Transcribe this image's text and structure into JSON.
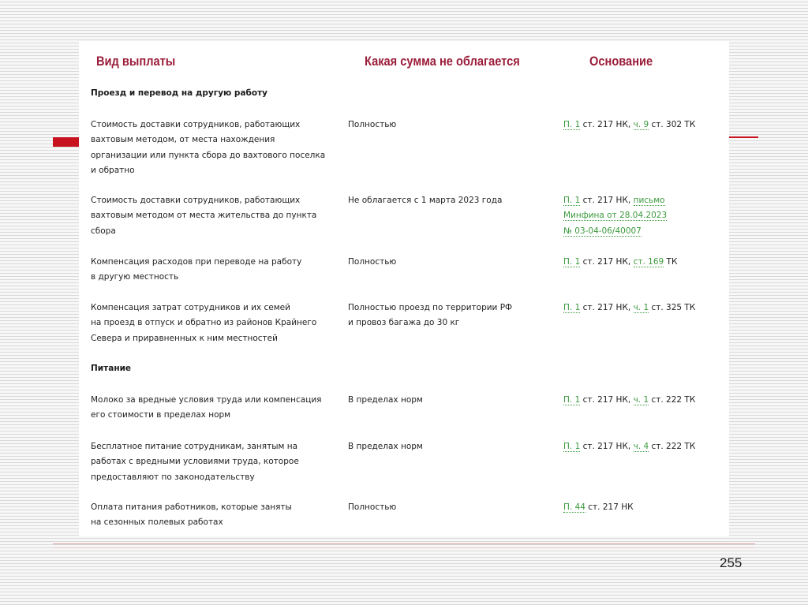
{
  "headers": {
    "col1": "Вид выплаты",
    "col2": "Какая сумма не облагается",
    "col3": "Основание"
  },
  "sections": [
    {
      "title": "Проезд и перевод на другую работу",
      "rows": [
        {
          "payment_lines": [
            "Стоимость доставки сотрудников, работающих",
            "вахтовым методом, от места нахождения",
            "организации или пункта сбора до вахтового поселка",
            "и обратно"
          ],
          "amount_lines": [
            "Полностью"
          ],
          "basis_lines": [
            [
              {
                "t": "П. 1",
                "link": true
              },
              {
                "t": " ст. 217 НК, ",
                "link": false
              },
              {
                "t": "ч. 9",
                "link": true
              },
              {
                "t": " ст. 302 ТК",
                "link": false
              }
            ]
          ]
        },
        {
          "payment_lines": [
            "Стоимость доставки сотрудников, работающих",
            "вахтовым методом от места жительства до пункта",
            "сбора"
          ],
          "amount_lines": [
            "Не облагается с 1 марта 2023 года"
          ],
          "basis_lines": [
            [
              {
                "t": "П. 1",
                "link": true
              },
              {
                "t": " ст. 217 НК, ",
                "link": false
              },
              {
                "t": "письмо",
                "link": true
              }
            ],
            [
              {
                "t": "Минфина от 28.04.2023",
                "link": true
              }
            ],
            [
              {
                "t": "№ 03-04-06/40007",
                "link": true
              }
            ]
          ]
        },
        {
          "payment_lines": [
            "Компенсация расходов при переводе на работу",
            "в другую местность"
          ],
          "amount_lines": [
            "Полностью"
          ],
          "basis_lines": [
            [
              {
                "t": "П. 1",
                "link": true
              },
              {
                "t": " ст. 217 НК, ",
                "link": false
              },
              {
                "t": "ст. 169",
                "link": true
              },
              {
                "t": " ТК",
                "link": false
              }
            ]
          ]
        },
        {
          "payment_lines": [
            "Компенсация затрат сотрудников и их семей",
            "на проезд в отпуск и обратно из районов Крайнего",
            "Севера и приравненных к ним местностей"
          ],
          "amount_lines": [
            "Полностью проезд по территории РФ",
            "и провоз багажа до 30 кг"
          ],
          "basis_lines": [
            [
              {
                "t": "П. 1",
                "link": true
              },
              {
                "t": " ст. 217 НК, ",
                "link": false
              },
              {
                "t": "ч. 1",
                "link": true
              },
              {
                "t": " ст. 325 ТК",
                "link": false
              }
            ]
          ]
        }
      ]
    },
    {
      "title": "Питание",
      "rows": [
        {
          "payment_lines": [
            "Молоко за вредные условия труда или компенсация",
            "его стоимости в пределах норм"
          ],
          "amount_lines": [
            "В пределах норм"
          ],
          "basis_lines": [
            [
              {
                "t": "П. 1",
                "link": true
              },
              {
                "t": " ст. 217 НК, ",
                "link": false
              },
              {
                "t": "ч. 1",
                "link": true
              },
              {
                "t": " ст. 222 ТК",
                "link": false
              }
            ]
          ]
        },
        {
          "payment_lines": [
            "Бесплатное питание сотрудникам, занятым на",
            "работах с вредными условиями труда, которое",
            "предоставляют по законодательству"
          ],
          "amount_lines": [
            "В пределах норм"
          ],
          "basis_lines": [
            [
              {
                "t": "П. 1",
                "link": true
              },
              {
                "t": " ст. 217 НК, ",
                "link": false
              },
              {
                "t": "ч. 4",
                "link": true
              },
              {
                "t": " ст. 222 ТК",
                "link": false
              }
            ]
          ]
        },
        {
          "payment_lines": [
            "Оплата питания работников, которые заняты",
            "на сезонных полевых работах"
          ],
          "amount_lines": [
            "Полностью"
          ],
          "basis_lines": [
            [
              {
                "t": "П. 44",
                "link": true
              },
              {
                "t": " ст. 217 НК",
                "link": false
              }
            ]
          ]
        }
      ]
    }
  ],
  "page_number": "255",
  "colors": {
    "header": "#9a1d3a",
    "link": "#3c9a3e",
    "accent": "#c7121f"
  }
}
